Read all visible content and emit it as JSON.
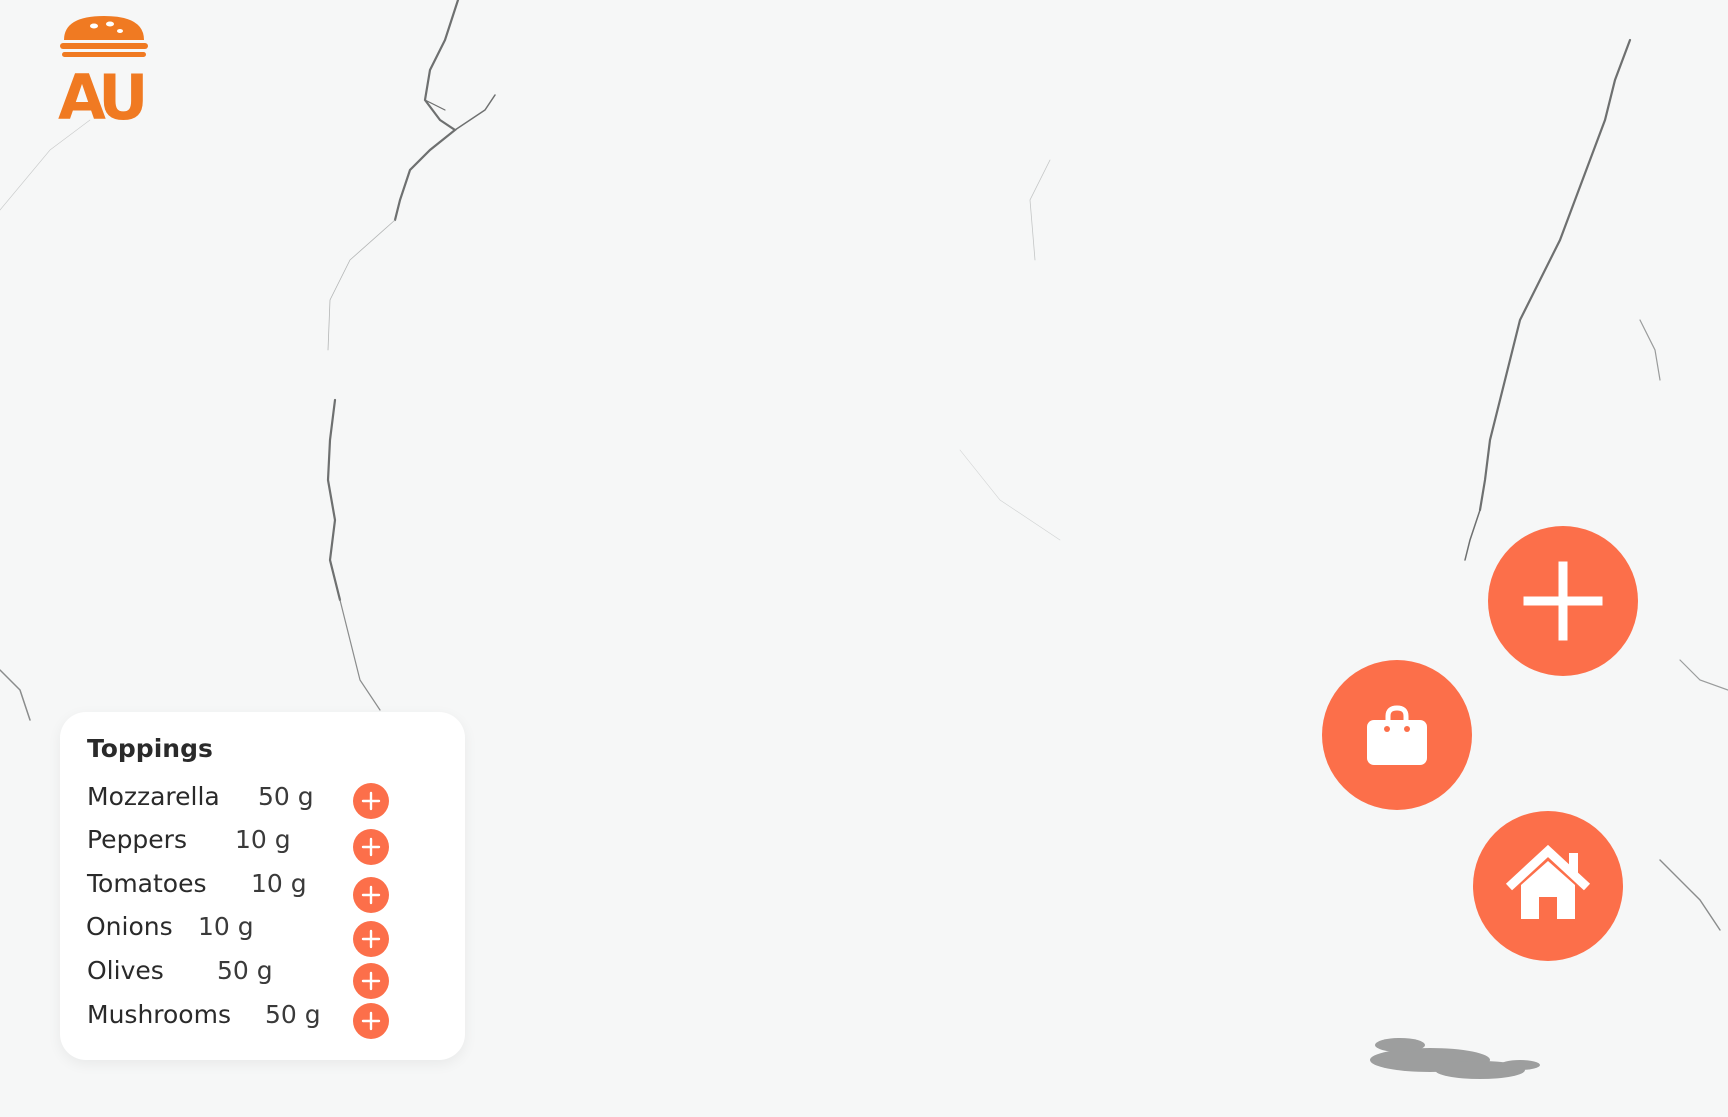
{
  "brand": {
    "logo_text": "AU",
    "accent": "#f07a22"
  },
  "toppings": {
    "title": "Toppings",
    "items": [
      {
        "name": "Mozzarella",
        "weight": "50 g"
      },
      {
        "name": "Peppers",
        "weight": "10 g"
      },
      {
        "name": "Tomatoes",
        "weight": "10 g"
      },
      {
        "name": "Onions",
        "weight": "10 g"
      },
      {
        "name": "Olives",
        "weight": "50 g"
      },
      {
        "name": "Mushrooms",
        "weight": "50 g"
      }
    ]
  },
  "actions": {
    "add_icon": "plus-icon",
    "cart_icon": "shopping-bag-icon",
    "home_icon": "home-icon",
    "color": "#fc6f4a"
  }
}
